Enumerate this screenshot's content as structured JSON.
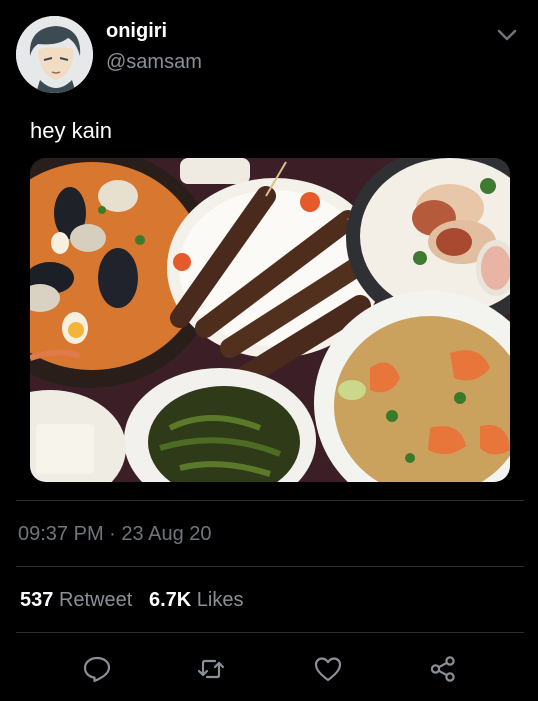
{
  "author": {
    "display_name": "onigiri",
    "handle": "@samsam"
  },
  "tweet": {
    "text": "hey kain",
    "time": "09:37 PM",
    "separator": "·",
    "date": "23 Aug 20"
  },
  "stats": {
    "retweets_count": "537",
    "retweets_label": "Retweet",
    "likes_count": "6.7K",
    "likes_label": "Likes"
  },
  "icons": {
    "menu": "chevron-down-icon",
    "reply": "reply-icon",
    "retweet": "retweet-icon",
    "like": "heart-icon",
    "share": "share-icon"
  },
  "colors": {
    "background": "#000000",
    "secondary_text": "#8a9096",
    "timestamp_text": "#6e767d",
    "divider": "#2b2f33"
  }
}
